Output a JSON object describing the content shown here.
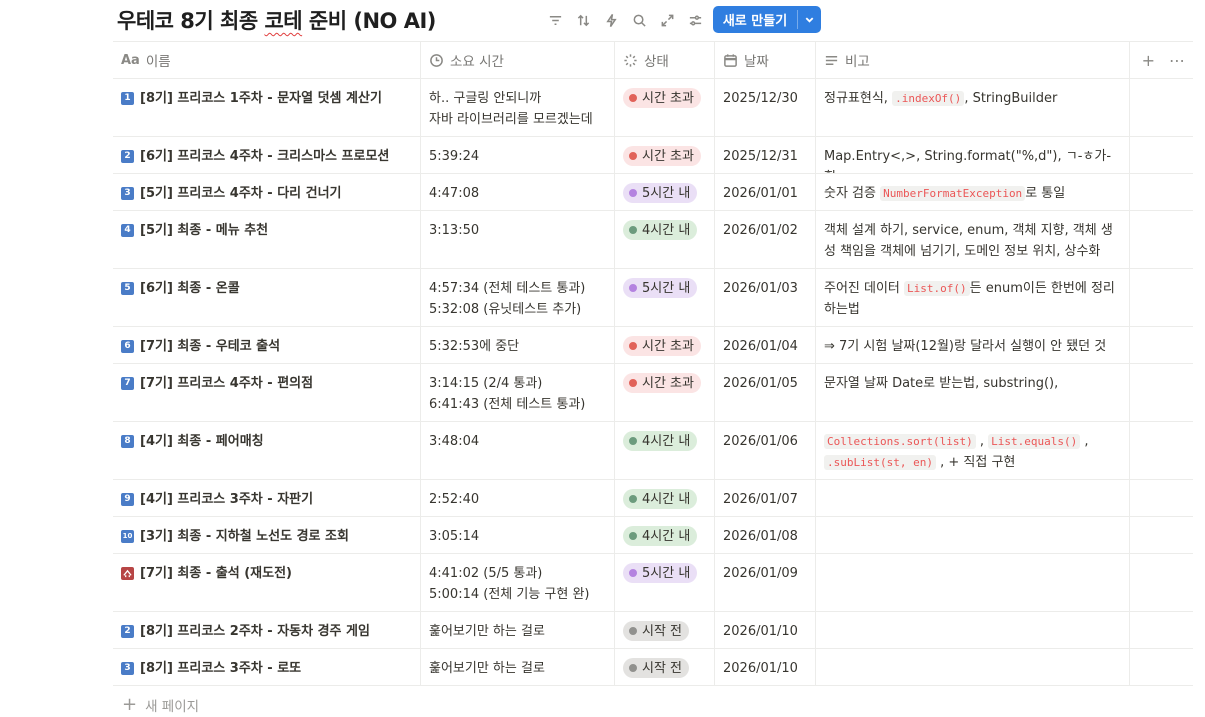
{
  "title": {
    "part1": "우테코 8기 최종 ",
    "part2": "코테",
    " part3": "",
    "part3": " 준비 (NO AI)"
  },
  "toolbar": {
    "new_label": "새로 만들기"
  },
  "columns": {
    "name": "이름",
    "duration": "소요 시간",
    "status": "상태",
    "date": "날짜",
    "note": "비고"
  },
  "icons": {
    "name_col": "Aa"
  },
  "status_colors": {
    "over": {
      "bg": "#fbe4e4",
      "dot": "#e16259"
    },
    "five": {
      "bg": "#eadff6",
      "dot": "#b483e0"
    },
    "four": {
      "bg": "#dbeddb",
      "dot": "#6c9b7d"
    },
    "notyet": {
      "bg": "#e3e2e0",
      "dot": "#91918e"
    }
  },
  "rows": [
    {
      "num": "1",
      "name": "[8기] 프리코스 1주차 - 문자열 덧셈 계산기",
      "duration": [
        "하.. 구글링 안되니까",
        "자바 라이브러리를 모르겠는데"
      ],
      "status": "시간 초과",
      "date": "2025/12/30",
      "note": [
        {
          "t": "정규표현식, "
        },
        {
          "c": ".indexOf()"
        },
        {
          "t": ", StringBuilder"
        }
      ]
    },
    {
      "num": "2",
      "name": "[6기] 프리코스 4주차 - 크리스마스 프로모션",
      "duration": [
        "5:39:24"
      ],
      "status": "시간 초과",
      "date": "2025/12/31",
      "note": [
        {
          "t": "Map.Entry<,>, String.format(\"%,d\"), ㄱ-ㅎ가-힣"
        }
      ]
    },
    {
      "num": "3",
      "name": "[5기] 프리코스 4주차 - 다리 건너기",
      "duration": [
        "4:47:08"
      ],
      "status": "5시간 내",
      "date": "2026/01/01",
      "note": [
        {
          "t": "숫자 검증 "
        },
        {
          "c": "NumberFormatException"
        },
        {
          "t": "로 통일"
        }
      ]
    },
    {
      "num": "4",
      "name": "[5기] 최종 - 메뉴 추천",
      "duration": [
        "3:13:50"
      ],
      "status": "4시간 내",
      "date": "2026/01/02",
      "note": [
        {
          "t": "객체 설계 하기, service, enum, 객체 지향, 객체 생성 책임을 객체에 넘기기, 도메인 정보 위치, 상수화"
        }
      ]
    },
    {
      "num": "5",
      "name": "[6기] 최종 - 온콜",
      "duration": [
        "4:57:34 (전체 테스트 통과)",
        "5:32:08 (유닛테스트 추가)"
      ],
      "status": "5시간 내",
      "date": "2026/01/03",
      "note": [
        {
          "t": "주어진 데이터 "
        },
        {
          "c": "List.of()"
        },
        {
          "t": "든 enum이든 한번에 정리하는법"
        }
      ]
    },
    {
      "num": "6",
      "name": "[7기] 최종 - 우테코 출석",
      "duration": [
        "5:32:53에 중단"
      ],
      "status": "시간 초과",
      "date": "2026/01/04",
      "note": [
        {
          "t": "⇒ 7기 시험 날짜(12월)랑 달라서 실행이 안 됐던 것"
        }
      ]
    },
    {
      "num": "7",
      "name": "[7기] 프리코스 4주차 - 편의점",
      "duration": [
        "3:14:15 (2/4 통과)",
        "6:41:43 (전체 테스트 통과)"
      ],
      "status": "시간 초과",
      "date": "2026/01/05",
      "note": [
        {
          "t": "문자열 날짜 Date로 받는법, substring(),"
        }
      ]
    },
    {
      "num": "8",
      "name": "[4기] 최종 - 페어매칭",
      "duration": [
        "3:48:04"
      ],
      "status": "4시간 내",
      "date": "2026/01/06",
      "note": [
        {
          "c": "Collections.sort(list)"
        },
        {
          "t": " , "
        },
        {
          "c": "List.equals()"
        },
        {
          "t": " , "
        },
        {
          "c": ".subList(st, en)"
        },
        {
          "t": " , + 직접 구현"
        }
      ]
    },
    {
      "num": "9",
      "name": "[4기] 프리코스 3주차 - 자판기",
      "duration": [
        "2:52:40"
      ],
      "status": "4시간 내",
      "date": "2026/01/07",
      "note": []
    },
    {
      "num": "10",
      "name": "[3기] 최종 - 지하철 노선도 경로 조회",
      "duration": [
        "3:05:14"
      ],
      "status": "4시간 내",
      "date": "2026/01/08",
      "note": []
    },
    {
      "num": "",
      "icon": "hundred-icon",
      "name": "[7기] 최종 - 출석 (재도전)",
      "duration": [
        "4:41:02 (5/5 통과)",
        "5:00:14 (전체 기능 구현 완)"
      ],
      "status": "5시간 내",
      "date": "2026/01/09",
      "note": []
    },
    {
      "num": "2",
      "name": "[8기] 프리코스 2주차 - 자동차 경주 게임",
      "duration": [
        "훑어보기만 하는 걸로"
      ],
      "status": "시작 전",
      "date": "2026/01/10",
      "note": []
    },
    {
      "num": "3",
      "name": "[8기] 프리코스 3주차 - 로또",
      "duration": [
        "훑어보기만 하는 걸로"
      ],
      "status": "시작 전",
      "date": "2026/01/10",
      "note": []
    }
  ],
  "new_page": "새 페이지"
}
